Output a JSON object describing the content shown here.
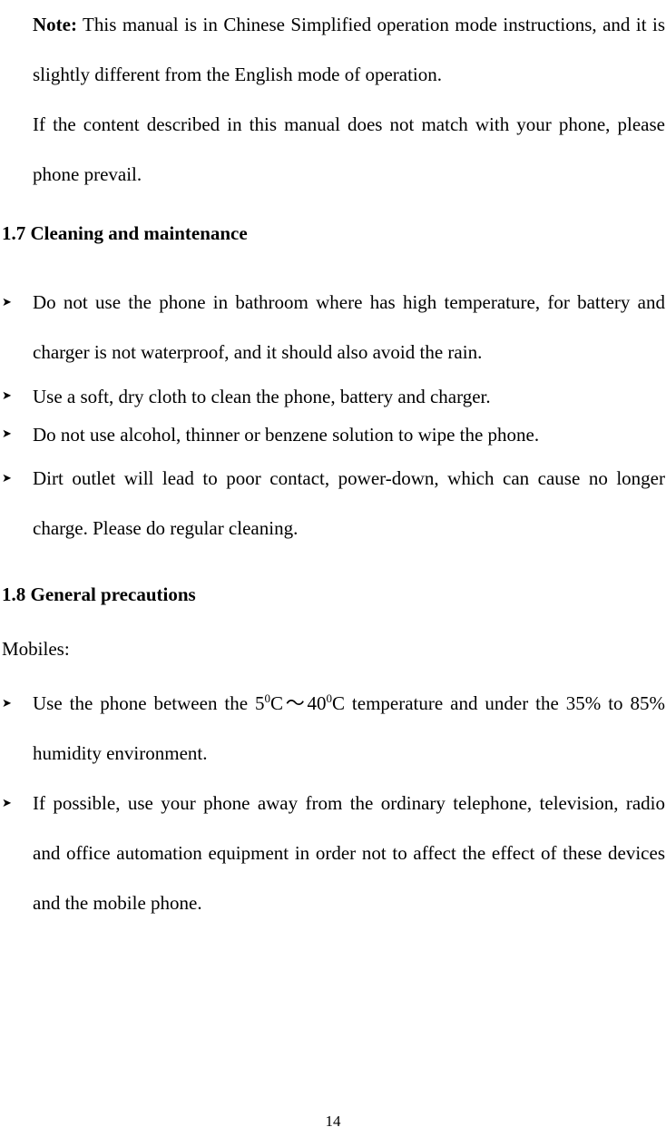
{
  "document": {
    "kind": "mobile-phone-user-manual-page",
    "page_number": "14"
  },
  "note_block": {
    "label": "Note:",
    "line_1": " This manual is in Chinese Simplified operation mode instructions, and it is slightly different from the English mode of operation.",
    "line_2": "If the content described in this manual does not match with your phone, please phone prevail."
  },
  "section_1_7": {
    "heading": "1.7 Cleaning and maintenance",
    "bullets": [
      "Do not use the phone in bathroom where has high temperature, for battery and charger is not waterproof, and it should also avoid the rain.",
      "Use a soft, dry cloth to clean the phone, battery and charger.",
      "Do not use alcohol, thinner or benzene solution to wipe the phone.",
      "Dirt outlet will lead to poor contact, power-down, which can cause no longer charge. Please do regular cleaning."
    ],
    "bullet_marker": "arrowhead-right"
  },
  "section_1_8": {
    "heading": "1.8 General precautions",
    "intro": "Mobiles:",
    "bullet_1": {
      "prefix": "Use the phone between the 5",
      "sup_1": "0",
      "mid_1": "C",
      "wave": "～",
      "mid_2": "40",
      "sup_2": "0",
      "mid_3": "C",
      "suffix": " temperature and under the 35% to 85% humidity environment."
    },
    "bullet_2": "If possible, use your phone away from the ordinary telephone, television, radio and office automation equipment in order not to affect the effect of these devices and the mobile phone.",
    "bullet_marker": "arrowhead-right"
  },
  "glyphs": {
    "arrow_bullet": "➤"
  }
}
